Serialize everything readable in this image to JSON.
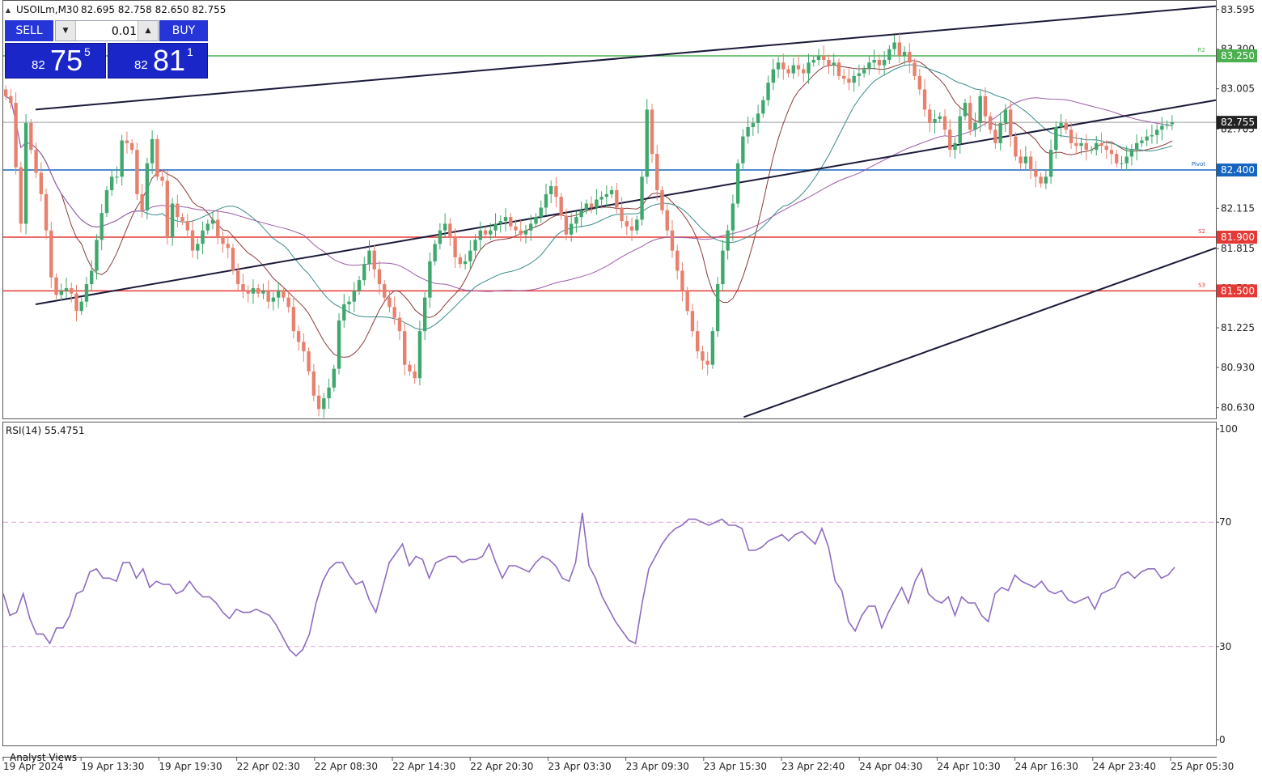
{
  "header": {
    "symbol": "USOILm,M30",
    "ohlc": "82.695 82.758 82.650 82.755"
  },
  "trade_panel": {
    "sell_label": "SELL",
    "buy_label": "BUY",
    "lot": "0.01",
    "sell_quote": {
      "prefix": "82",
      "big": "75",
      "sup": "5"
    },
    "buy_quote": {
      "prefix": "82",
      "big": "81",
      "sup": "1"
    },
    "sell_color": "#1a26c8"
  },
  "rsi_label": "RSI(14) 55.4751",
  "analyst_label": "Analyst Views",
  "colors": {
    "bull": "#3fa86c",
    "bear": "#e8806e",
    "resistance_green": "#4caf50",
    "pivot_blue": "#1565c0",
    "support_red": "#e53935",
    "rsi_line": "#8e6cc0",
    "ma_fast": "#8b3a3a",
    "ma_mid": "#3a8b8b",
    "ma_slow": "#9b5ca6"
  },
  "chart_data": {
    "type": "candlestick",
    "price_axis": {
      "ylim": [
        80.55,
        83.66
      ],
      "ticks": [
        "83.595",
        "83.300",
        "83.005",
        "82.705",
        "82.115",
        "81.815",
        "81.520",
        "81.225",
        "80.930",
        "80.630"
      ]
    },
    "levels": [
      {
        "label": "R2",
        "value": 83.25,
        "price_tag": "83.250",
        "color": "#4caf50"
      },
      {
        "label": "Pivot",
        "value": 82.4,
        "price_tag": "82.400",
        "color": "#1565c0"
      },
      {
        "label": "S2",
        "value": 81.9,
        "price_tag": "81.900",
        "color": "#e53935"
      },
      {
        "label": "S3",
        "value": 81.5,
        "price_tag": "81.500",
        "color": "#e53935"
      }
    ],
    "current_price": {
      "value": 82.755,
      "price_tag": "82.755"
    },
    "x_labels": [
      "19 Apr 2024",
      "19 Apr 13:30",
      "19 Apr 19:30",
      "22 Apr 02:30",
      "22 Apr 08:30",
      "22 Apr 14:30",
      "22 Apr 20:30",
      "23 Apr 03:30",
      "23 Apr 09:30",
      "23 Apr 15:30",
      "23 Apr 22:40",
      "24 Apr 04:30",
      "24 Apr 10:30",
      "24 Apr 16:30",
      "24 Apr 23:40",
      "25 Apr 05:30"
    ],
    "channel_lines": [
      {
        "from": [
          0,
          82.85
        ],
        "to": [
          18.6,
          83.62
        ]
      },
      {
        "from": [
          0,
          81.4
        ],
        "to": [
          30.4,
          82.92
        ]
      },
      {
        "from": [
          9.1,
          80.56
        ],
        "to": [
          30.4,
          81.82
        ]
      }
    ],
    "closes": [
      82.95,
      82.9,
      82.42,
      82.0,
      82.75,
      82.55,
      82.38,
      82.22,
      81.95,
      81.6,
      81.47,
      81.5,
      81.52,
      81.48,
      81.35,
      81.42,
      81.55,
      81.65,
      81.88,
      82.08,
      82.25,
      82.35,
      82.35,
      82.62,
      82.6,
      82.55,
      82.22,
      82.1,
      82.45,
      82.63,
      82.35,
      82.32,
      81.9,
      82.15,
      82.05,
      82.02,
      81.95,
      81.8,
      81.85,
      81.95,
      82.0,
      82.03,
      81.9,
      81.85,
      81.82,
      81.65,
      81.55,
      81.5,
      81.48,
      81.52,
      81.48,
      81.5,
      81.42,
      81.45,
      81.5,
      81.45,
      81.38,
      81.2,
      81.12,
      81.05,
      80.9,
      80.72,
      80.62,
      80.7,
      80.78,
      80.92,
      81.28,
      81.4,
      81.42,
      81.5,
      81.58,
      81.7,
      81.8,
      81.66,
      81.55,
      81.45,
      81.38,
      81.3,
      81.2,
      80.95,
      80.9,
      80.85,
      81.2,
      81.45,
      81.72,
      81.85,
      81.95,
      82.0,
      81.9,
      81.75,
      81.7,
      81.72,
      81.8,
      81.88,
      81.95,
      81.92,
      81.95,
      82.0,
      82.02,
      82.05,
      81.98,
      81.95,
      81.92,
      81.95,
      82.0,
      82.05,
      82.12,
      82.22,
      82.28,
      82.2,
      82.06,
      81.92,
      82.0,
      82.05,
      82.1,
      82.15,
      82.12,
      82.18,
      82.2,
      82.22,
      82.25,
      82.12,
      82.02,
      81.98,
      81.95,
      82.03,
      82.35,
      82.85,
      82.52,
      82.25,
      82.1,
      81.95,
      81.8,
      81.65,
      81.5,
      81.35,
      81.2,
      81.05,
      80.98,
      80.95,
      81.2,
      81.55,
      81.8,
      81.95,
      82.15,
      82.45,
      82.65,
      82.72,
      82.75,
      82.82,
      82.92,
      83.05,
      83.15,
      83.2,
      83.15,
      83.12,
      83.18,
      83.15,
      83.12,
      83.2,
      83.22,
      83.25,
      83.22,
      83.18,
      83.2,
      83.1,
      83.08,
      83.05,
      83.1,
      83.12,
      83.15,
      83.2,
      83.22,
      83.18,
      83.22,
      83.3,
      83.35,
      83.25,
      83.28,
      83.2,
      83.1,
      83.0,
      82.85,
      82.75,
      82.78,
      82.8,
      82.7,
      82.55,
      82.6,
      82.8,
      82.9,
      82.7,
      82.75,
      82.95,
      82.8,
      82.7,
      82.6,
      82.75,
      82.85,
      82.65,
      82.5,
      82.45,
      82.5,
      82.4,
      82.35,
      82.3,
      82.35,
      82.55,
      82.72,
      82.75,
      82.7,
      82.6,
      82.58,
      82.6,
      82.55,
      82.55,
      82.6,
      82.58,
      82.55,
      82.52,
      82.45,
      82.45,
      82.5,
      82.55,
      82.6,
      82.62,
      82.65,
      82.66,
      82.7,
      82.73,
      82.74,
      82.755
    ],
    "rsi": {
      "label": "RSI(14)",
      "value": 55.4751,
      "ylim": [
        0,
        100
      ],
      "levels": [
        30,
        70
      ],
      "ticks": [
        "100",
        "70",
        "30",
        "0"
      ],
      "values": [
        47,
        40,
        41,
        47,
        39,
        34,
        34,
        31,
        36,
        36,
        40,
        47,
        48,
        54,
        55,
        52,
        52,
        51,
        57,
        57,
        52,
        55,
        49,
        51,
        50,
        50,
        47,
        48,
        51,
        48,
        46,
        46,
        44,
        41,
        39,
        42,
        41,
        41,
        42,
        41,
        40,
        37,
        33,
        29,
        27,
        29,
        34,
        44,
        51,
        55,
        57,
        57,
        53,
        50,
        51,
        45,
        41,
        49,
        57,
        60,
        63,
        56,
        59,
        58,
        52,
        57,
        58,
        59,
        59,
        57,
        58,
        58,
        59,
        63,
        57,
        52,
        56,
        56,
        55,
        54,
        57,
        59,
        58,
        56,
        52,
        51,
        57,
        73,
        56,
        52,
        46,
        42,
        38,
        35,
        32,
        31,
        44,
        55,
        59,
        63,
        66,
        68,
        69,
        71,
        71,
        70,
        69,
        70,
        71,
        69,
        69,
        68,
        61,
        61,
        62,
        64,
        65,
        66,
        64,
        66,
        67,
        65,
        63,
        68,
        62,
        51,
        48,
        38,
        35,
        40,
        43,
        43,
        36,
        41,
        45,
        49,
        44,
        51,
        55,
        47,
        45,
        44,
        46,
        40,
        46,
        44,
        44,
        40,
        38,
        47,
        49,
        48,
        53,
        51,
        50,
        49,
        51,
        48,
        47,
        48,
        45,
        44,
        45,
        46,
        42,
        47,
        48,
        49,
        53,
        54,
        52,
        54,
        55,
        55,
        52,
        53,
        55.5
      ]
    }
  }
}
